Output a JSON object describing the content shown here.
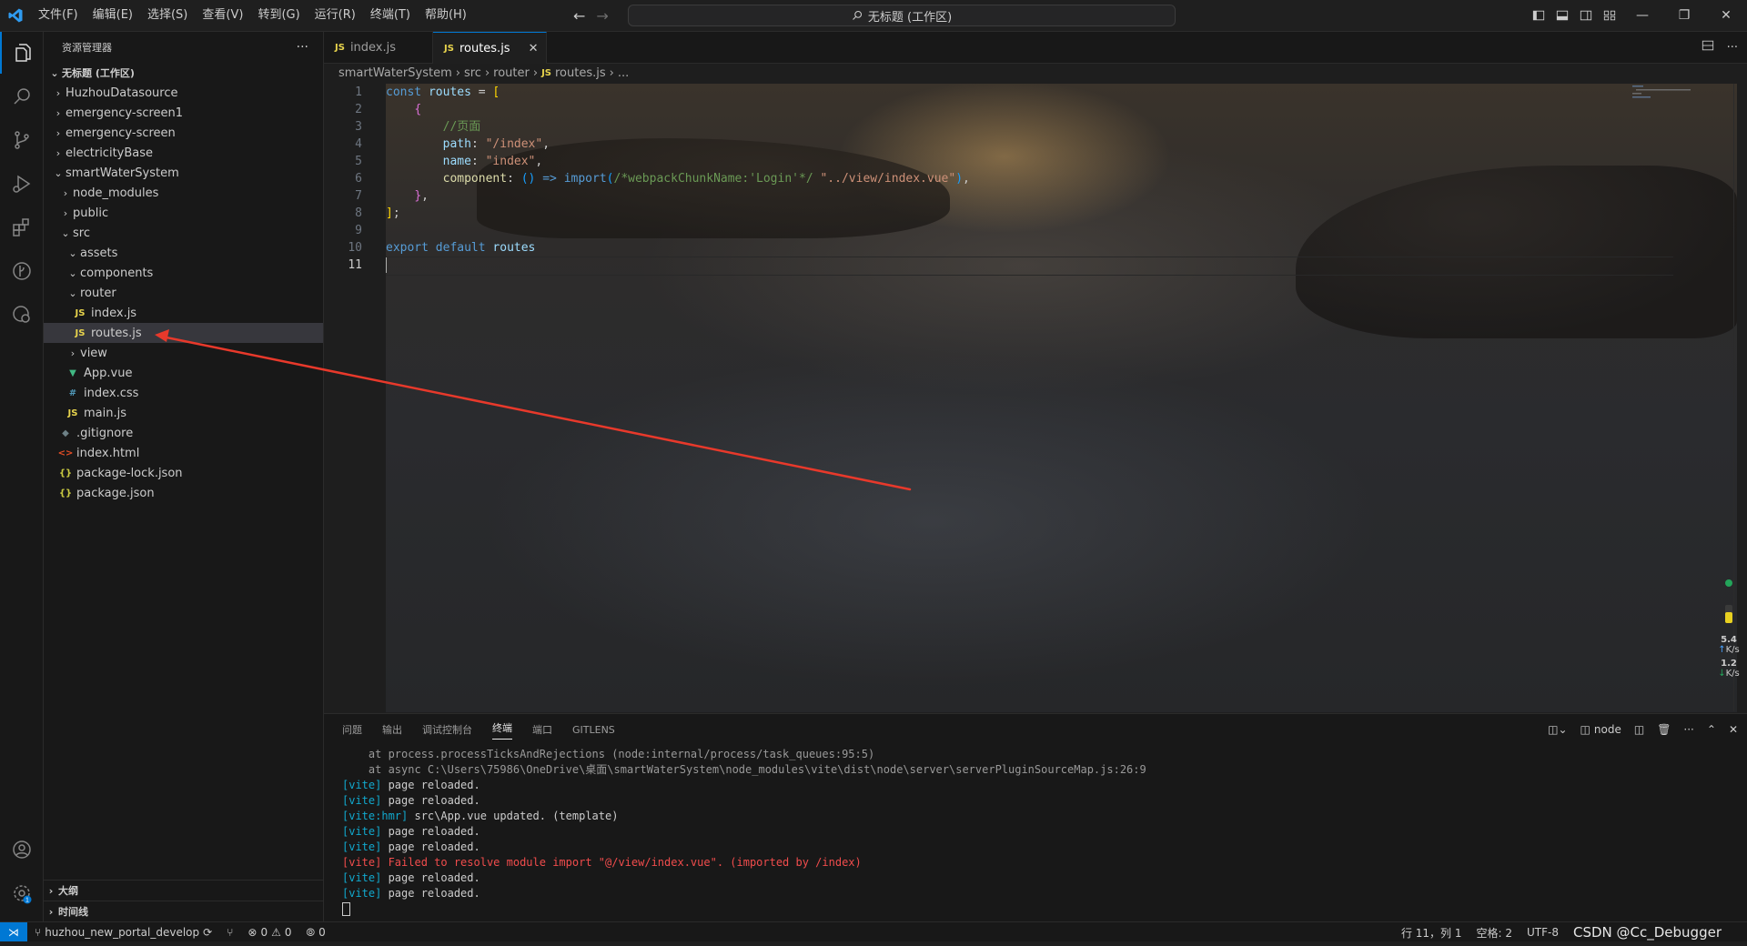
{
  "menu": [
    "文件(F)",
    "编辑(E)",
    "选择(S)",
    "查看(V)",
    "转到(G)",
    "运行(R)",
    "终端(T)",
    "帮助(H)"
  ],
  "command_center": "无标题 (工作区)",
  "sidebar": {
    "title": "资源管理器",
    "more": "···",
    "workspace": "无标题 (工作区)",
    "tree": [
      {
        "label": "HuzhouDatasource",
        "depth": 1,
        "kind": "folder",
        "open": false
      },
      {
        "label": "emergency-screen1",
        "depth": 1,
        "kind": "folder",
        "open": false
      },
      {
        "label": "emergency-screen",
        "depth": 1,
        "kind": "folder",
        "open": false
      },
      {
        "label": "electricityBase",
        "depth": 1,
        "kind": "folder",
        "open": false
      },
      {
        "label": "smartWaterSystem",
        "depth": 1,
        "kind": "folder",
        "open": true
      },
      {
        "label": "node_modules",
        "depth": 2,
        "kind": "folder",
        "open": false
      },
      {
        "label": "public",
        "depth": 2,
        "kind": "folder",
        "open": false
      },
      {
        "label": "src",
        "depth": 2,
        "kind": "folder",
        "open": true
      },
      {
        "label": "assets",
        "depth": 3,
        "kind": "folder",
        "open": true
      },
      {
        "label": "components",
        "depth": 3,
        "kind": "folder",
        "open": true
      },
      {
        "label": "router",
        "depth": 3,
        "kind": "folder",
        "open": true
      },
      {
        "label": "index.js",
        "depth": 4,
        "kind": "js"
      },
      {
        "label": "routes.js",
        "depth": 4,
        "kind": "js",
        "selected": true
      },
      {
        "label": "view",
        "depth": 3,
        "kind": "folder",
        "open": false
      },
      {
        "label": "App.vue",
        "depth": 3,
        "kind": "vue"
      },
      {
        "label": "index.css",
        "depth": 3,
        "kind": "css"
      },
      {
        "label": "main.js",
        "depth": 3,
        "kind": "js"
      },
      {
        "label": ".gitignore",
        "depth": 2,
        "kind": "git"
      },
      {
        "label": "index.html",
        "depth": 2,
        "kind": "html"
      },
      {
        "label": "package-lock.json",
        "depth": 2,
        "kind": "json"
      },
      {
        "label": "package.json",
        "depth": 2,
        "kind": "json"
      }
    ],
    "outline": "大纲",
    "timeline": "时间线"
  },
  "tabs": [
    {
      "label": "index.js",
      "active": false
    },
    {
      "label": "routes.js",
      "active": true
    }
  ],
  "breadcrumbs": [
    "smartWaterSystem",
    "src",
    "router",
    "routes.js",
    "..."
  ],
  "code": {
    "line_numbers": [
      "1",
      "2",
      "3",
      "4",
      "5",
      "6",
      "7",
      "8",
      "9",
      "10",
      "11"
    ],
    "current_line": "11"
  },
  "panel": {
    "tabs": [
      "问题",
      "输出",
      "调试控制台",
      "终端",
      "端口",
      "GITLENS"
    ],
    "active_tab": "终端",
    "terminal_name": "node",
    "lines": [
      {
        "type": "plain",
        "text": "    at process.processTicksAndRejections (node:internal/process/task_queues:95:5)"
      },
      {
        "type": "plain",
        "text": "    at async C:\\Users\\75986\\OneDrive\\桌面\\smartWaterSystem\\node_modules\\vite\\dist\\node\\server\\serverPluginSourceMap.js:26:9"
      },
      {
        "type": "vite",
        "prefix": "[vite]",
        "text": " page reloaded."
      },
      {
        "type": "vite",
        "prefix": "[vite]",
        "text": " page reloaded."
      },
      {
        "type": "vite",
        "prefix": "[vite:hmr]",
        "text": " src\\App.vue updated. (template)"
      },
      {
        "type": "vite",
        "prefix": "[vite]",
        "text": " page reloaded."
      },
      {
        "type": "vite",
        "prefix": "[vite]",
        "text": " page reloaded."
      },
      {
        "type": "error",
        "prefix": "[vite]",
        "text": " Failed to resolve module import \"@/view/index.vue\". (imported by /index)"
      },
      {
        "type": "vite",
        "prefix": "[vite]",
        "text": " page reloaded."
      },
      {
        "type": "vite",
        "prefix": "[vite]",
        "text": " page reloaded."
      }
    ]
  },
  "status": {
    "branch": "huzhou_new_portal_develop",
    "errors": "0",
    "warnings": "0",
    "ports": "0",
    "position": "行 11，列 1",
    "spaces": "空格: 2",
    "encoding": "UTF-8",
    "watermark": "CSDN @Cc_Debugger"
  },
  "net_monitor": {
    "up": "5.4",
    "up_unit": "K/s",
    "down": "1.2",
    "down_unit": "K/s"
  },
  "accent_color": "#0078d4",
  "annotation_arrow_color": "#e8392b"
}
